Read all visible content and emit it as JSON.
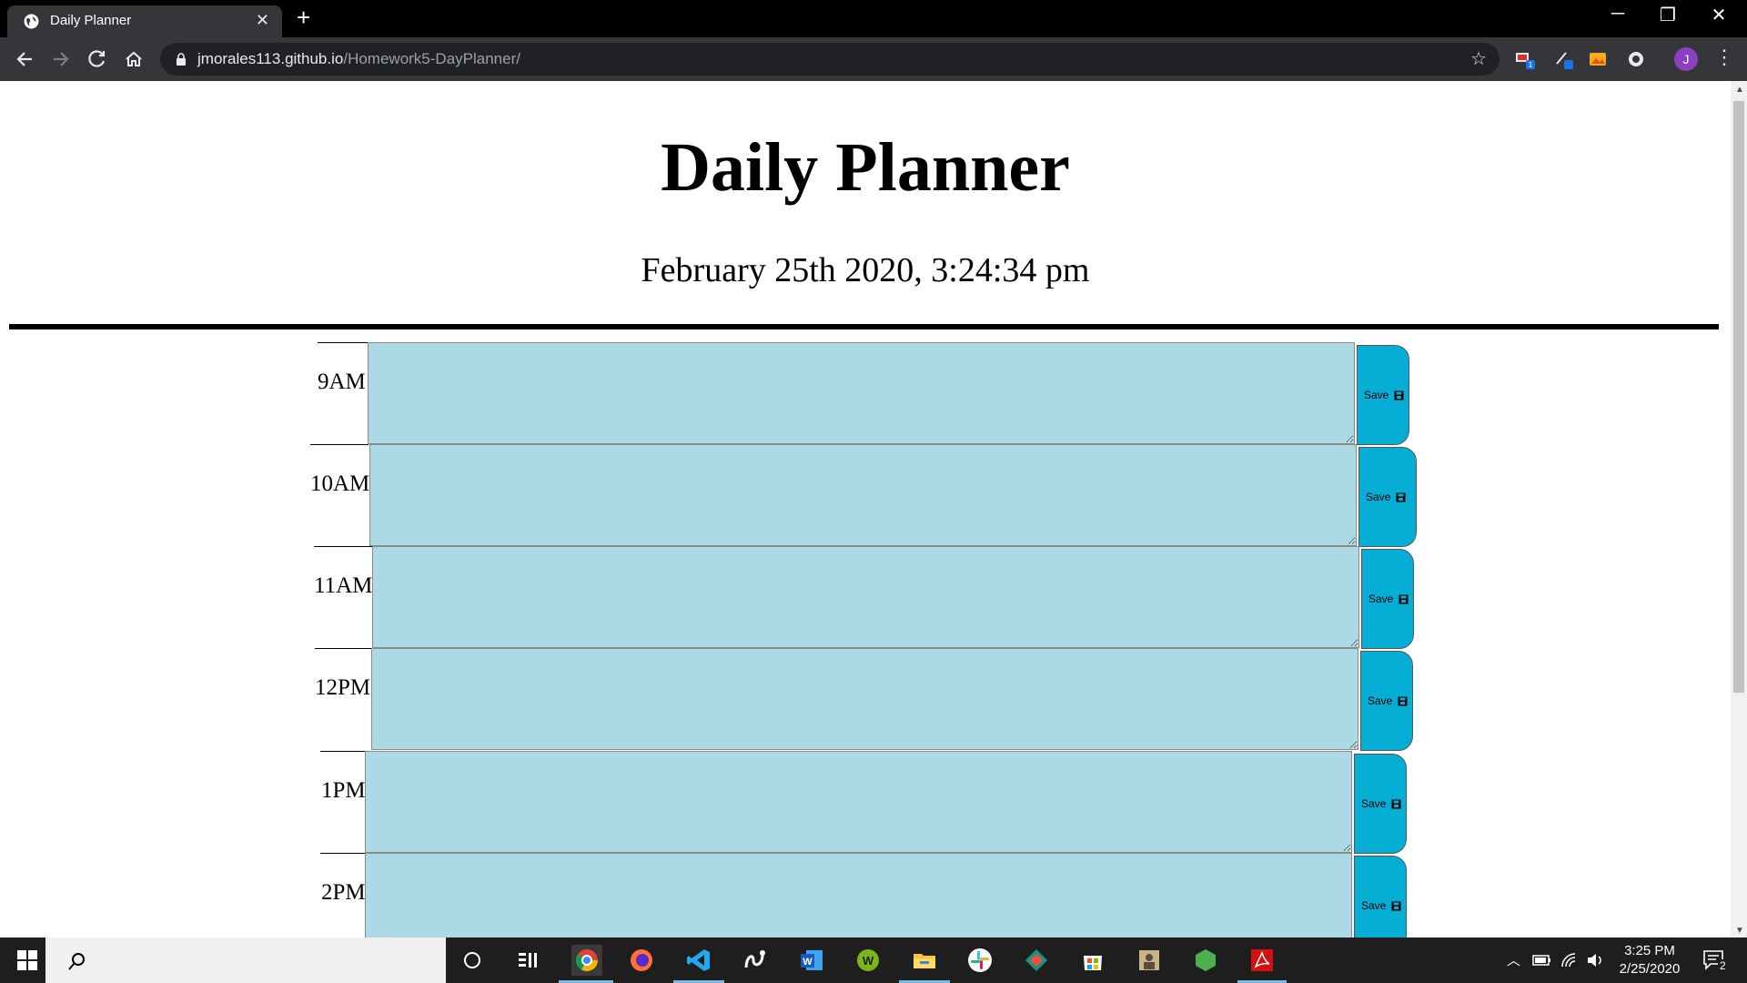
{
  "browser": {
    "tab_title": "Daily Planner",
    "url_host": "jmorales113.github.io",
    "url_path": "/Homework5-DayPlanner/",
    "profile_initial": "J"
  },
  "page": {
    "title": "Daily Planner",
    "current_datetime": "February 25th 2020, 3:24:34 pm"
  },
  "time_blocks": [
    {
      "hour": "9AM",
      "text": "",
      "save_label": "Save"
    },
    {
      "hour": "10AM",
      "text": "",
      "save_label": "Save"
    },
    {
      "hour": "11AM",
      "text": "",
      "save_label": "Save"
    },
    {
      "hour": "12PM",
      "text": "",
      "save_label": "Save"
    },
    {
      "hour": "1PM",
      "text": "",
      "save_label": "Save"
    },
    {
      "hour": "2PM",
      "text": "",
      "save_label": "Save"
    }
  ],
  "taskbar": {
    "time": "3:25 PM",
    "date": "2/25/2020",
    "notification_count": "2"
  },
  "colors": {
    "block_fill": "#add8e6",
    "save_button": "#06aed5"
  }
}
